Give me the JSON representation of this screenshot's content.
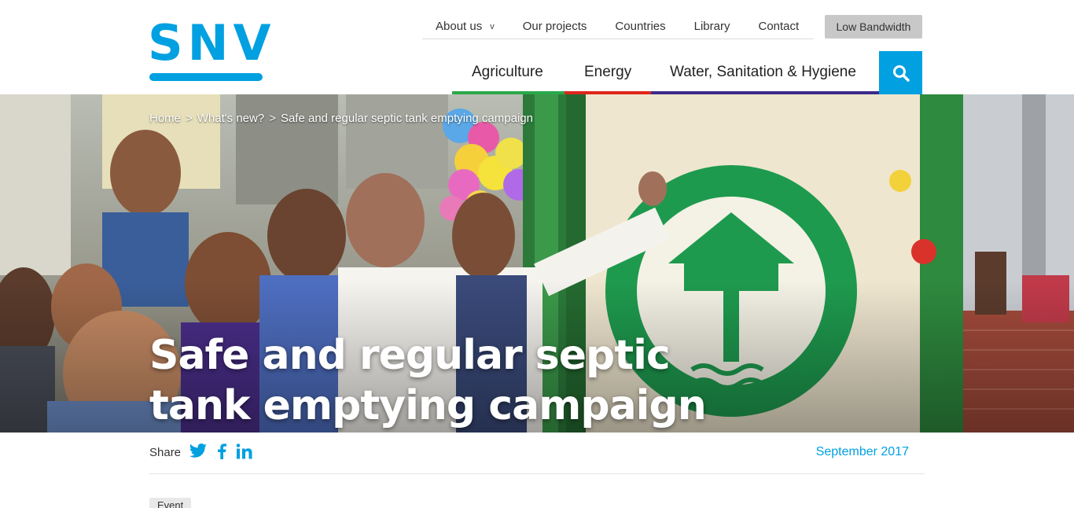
{
  "brand": {
    "logo_text": "SNV",
    "accent_color": "#00a0e1"
  },
  "topnav": {
    "items": [
      {
        "label": "About us",
        "has_dropdown": true
      },
      {
        "label": "Our projects"
      },
      {
        "label": "Countries"
      },
      {
        "label": "Library"
      },
      {
        "label": "Contact"
      }
    ],
    "low_bandwidth_label": "Low Bandwidth"
  },
  "mainnav": {
    "items": [
      {
        "label": "Agriculture",
        "underline_color": "#2aa84a"
      },
      {
        "label": "Energy",
        "underline_color": "#e0261b"
      },
      {
        "label": "Water, Sanitation & Hygiene",
        "underline_color": "#3d2a8a"
      }
    ],
    "search_icon": "search-icon"
  },
  "breadcrumb": {
    "items": [
      "Home",
      "What's new?",
      "Safe and regular septic tank emptying campaign"
    ],
    "separator": ">"
  },
  "hero": {
    "title": "Safe and regular septic tank emptying campaign"
  },
  "share": {
    "label": "Share",
    "icons": [
      "twitter-icon",
      "facebook-icon",
      "linkedin-icon"
    ]
  },
  "article": {
    "date": "September 2017",
    "tag": "Event"
  }
}
